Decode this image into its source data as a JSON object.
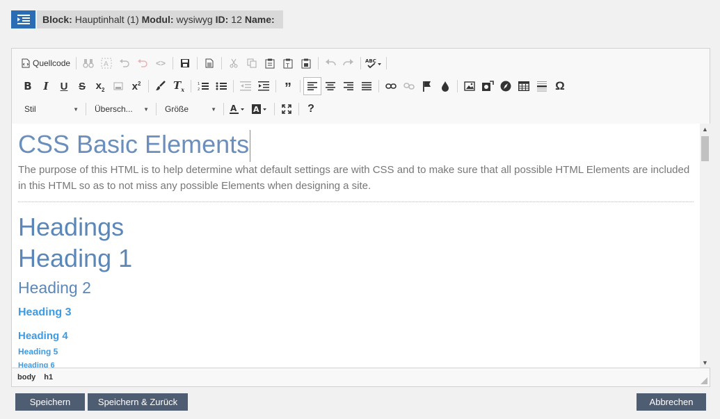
{
  "block": {
    "label_block": "Block:",
    "value_block": "Hauptinhalt (1)",
    "label_modul": "Modul:",
    "value_modul": "wysiwyg",
    "label_id": "ID:",
    "value_id": "12",
    "label_name": "Name:"
  },
  "toolbar": {
    "source_label": "Quellcode",
    "combos": {
      "style": "Stil",
      "format": "Übersch...",
      "size": "Größe"
    }
  },
  "content": {
    "title": "CSS Basic Elements",
    "intro": "The purpose of this HTML is to help determine what default settings are with CSS and to make sure that all possible HTML Elements are included in this HTML so as to not miss any possible Elements when designing a site.",
    "headings_title": "Headings",
    "h1": "Heading 1",
    "h2": "Heading 2",
    "h3": "Heading 3",
    "h4": "Heading 4",
    "h5": "Heading 5",
    "h6": "Heading 6"
  },
  "statusbar": {
    "path": [
      "body",
      "h1"
    ]
  },
  "actions": {
    "save": "Speichern",
    "save_back": "Speichern & Zurück",
    "cancel": "Abbrechen"
  },
  "colors": {
    "toggle_bg": "#2a6db5",
    "button_bg": "#4f5d73",
    "heading": "#5b87b8",
    "heading_small": "#3d9be3"
  }
}
